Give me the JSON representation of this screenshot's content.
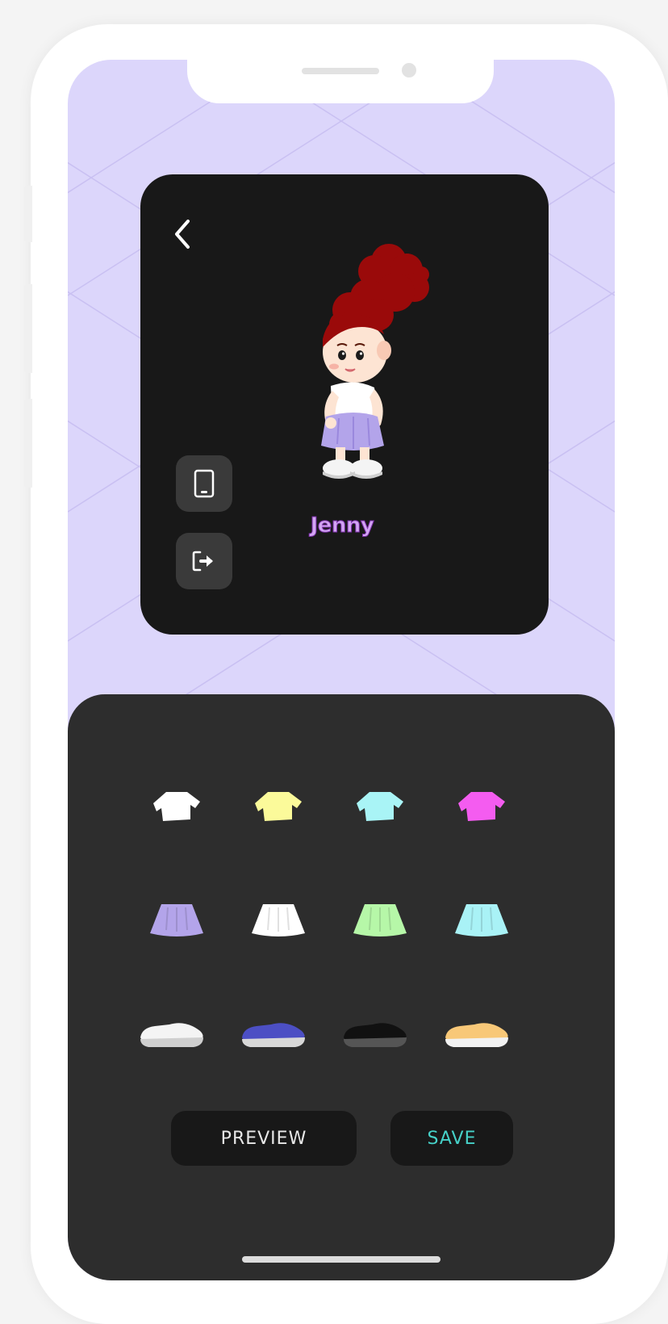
{
  "character": {
    "name": "Jenny"
  },
  "icons": {
    "back": "chevron-left-icon",
    "device": "mobile-device-icon",
    "logout": "sign-out-icon"
  },
  "wardrobe": {
    "tops": [
      {
        "name": "white-shirt",
        "color": "#ffffff"
      },
      {
        "name": "yellow-shirt",
        "color": "#fbfa9a"
      },
      {
        "name": "cyan-shirt",
        "color": "#a9f4f6"
      },
      {
        "name": "pink-shirt",
        "color": "#f45cf0"
      }
    ],
    "skirts": [
      {
        "name": "purple-skirt",
        "color": "#b3a4ea"
      },
      {
        "name": "white-skirt",
        "color": "#ffffff"
      },
      {
        "name": "green-skirt",
        "color": "#b6f7a8"
      },
      {
        "name": "cyan-skirt",
        "color": "#a9f2f6"
      }
    ],
    "shoes": [
      {
        "name": "white-shoes",
        "color": "#f4f4f4",
        "sole": "#cfcfcf"
      },
      {
        "name": "blue-shoes",
        "color": "#4c4fc4",
        "sole": "#d8d8d8"
      },
      {
        "name": "black-shoes",
        "color": "#111111",
        "sole": "#555555"
      },
      {
        "name": "orange-shoes",
        "color": "#f8c878",
        "sole": "#f2f2f2"
      }
    ]
  },
  "actions": {
    "preview_label": "PREVIEW",
    "save_label": "SAVE"
  },
  "colors": {
    "background": "#dcd6fb",
    "card": "#181818",
    "panel": "#2d2d2d",
    "accent_save": "#46d1c8",
    "name_fill": "#d3a5f3",
    "hair": "#9a0a0a"
  }
}
